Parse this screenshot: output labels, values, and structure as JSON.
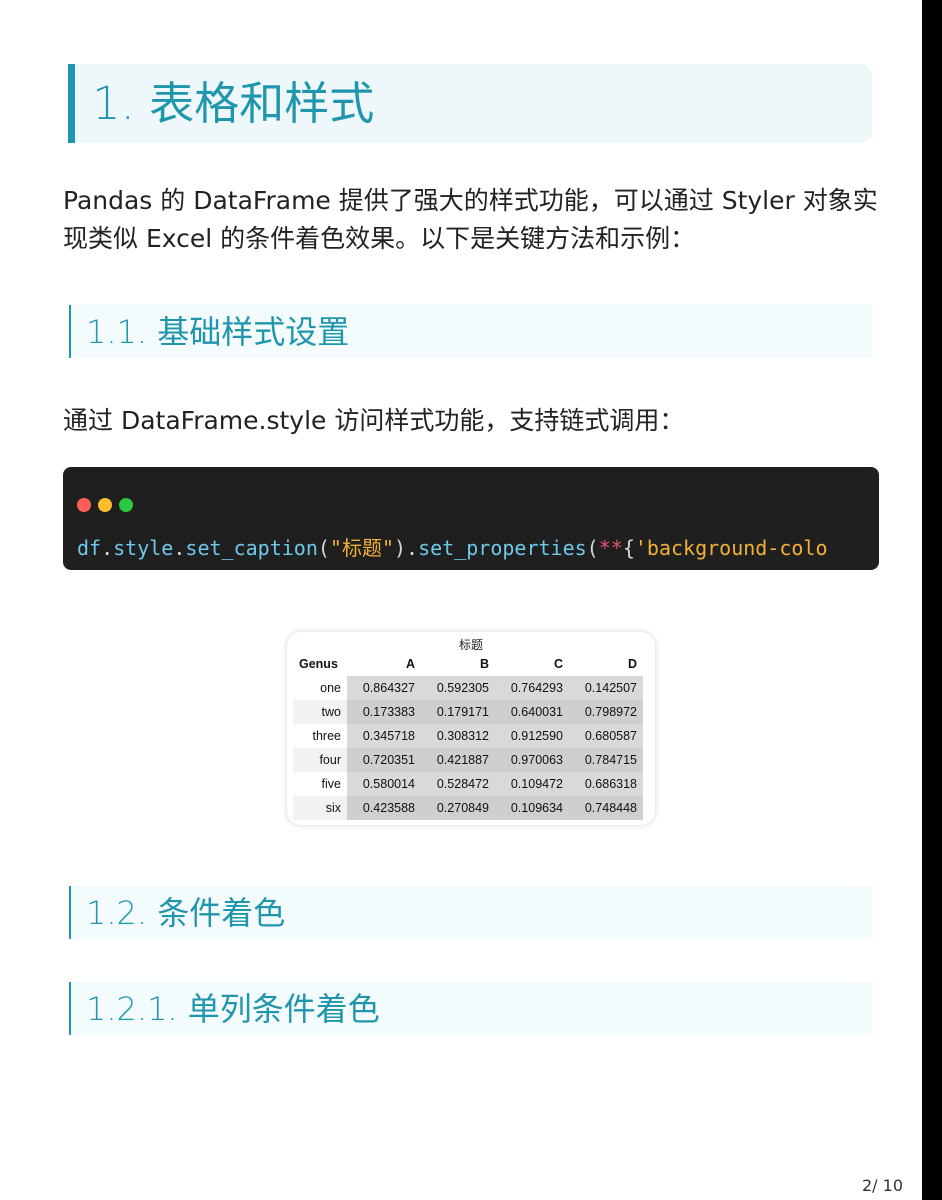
{
  "heading1": "1. 表格和样式",
  "intro": "Pandas 的 DataFrame 提供了强大的样式功能，可以通过 Styler 对象实现类似 Excel 的条件着色效果。以下是关键方法和示例：",
  "heading2_basic": "1.1. 基础样式设置",
  "basic_text": "通过 DataFrame.style 访问样式功能，支持链式调用：",
  "code": {
    "tokens": [
      {
        "t": "df",
        "c": "fn"
      },
      {
        "t": ".",
        "c": "pn"
      },
      {
        "t": "style",
        "c": "fn"
      },
      {
        "t": ".",
        "c": "pn"
      },
      {
        "t": "set_caption",
        "c": "fn"
      },
      {
        "t": "(",
        "c": "pn"
      },
      {
        "t": "\"标题\"",
        "c": "st"
      },
      {
        "t": ")",
        "c": "pn"
      },
      {
        "t": ".",
        "c": "pn"
      },
      {
        "t": "set_properties",
        "c": "fn"
      },
      {
        "t": "(",
        "c": "pn"
      },
      {
        "t": "**",
        "c": "op"
      },
      {
        "t": "{",
        "c": "pn"
      },
      {
        "t": "'background-colo",
        "c": "st"
      }
    ],
    "window_dots": [
      "#ff5f57",
      "#febc2e",
      "#28c840"
    ]
  },
  "table": {
    "caption": "标题",
    "index_name": "Genus",
    "columns": [
      "A",
      "B",
      "C",
      "D"
    ],
    "rows": [
      {
        "index": "one",
        "values": [
          "0.864327",
          "0.592305",
          "0.764293",
          "0.142507"
        ]
      },
      {
        "index": "two",
        "values": [
          "0.173383",
          "0.179171",
          "0.640031",
          "0.798972"
        ]
      },
      {
        "index": "three",
        "values": [
          "0.345718",
          "0.308312",
          "0.912590",
          "0.680587"
        ]
      },
      {
        "index": "four",
        "values": [
          "0.720351",
          "0.421887",
          "0.970063",
          "0.784715"
        ]
      },
      {
        "index": "five",
        "values": [
          "0.580014",
          "0.528472",
          "0.109472",
          "0.686318"
        ]
      },
      {
        "index": "six",
        "values": [
          "0.423588",
          "0.270849",
          "0.109634",
          "0.748448"
        ]
      }
    ]
  },
  "heading2_cond": "1.2. 条件着色",
  "heading3_single": "1.2.1. 单列条件着色",
  "page_number": "2/ 10",
  "colors": {
    "accent": "#1f96ad",
    "code_bg": "#1f1f1f"
  }
}
